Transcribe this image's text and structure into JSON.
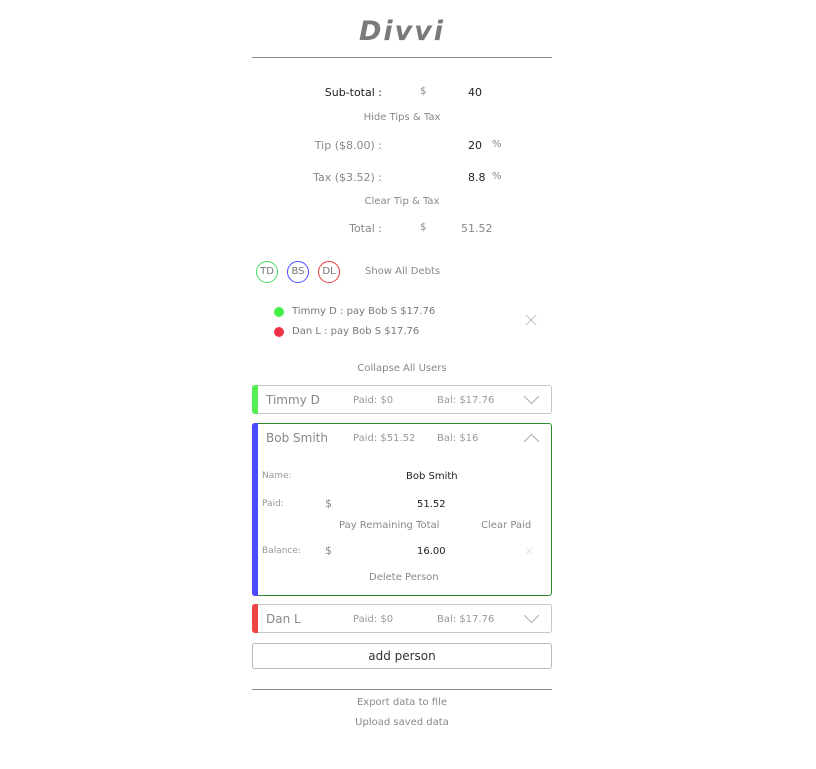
{
  "app": {
    "title": "Divvi"
  },
  "calc": {
    "subtotal_label": "Sub-total :",
    "currency": "$",
    "subtotal_value": "40",
    "hide_tips_label": "Hide Tips & Tax",
    "tip_label": "Tip ($8.00) :",
    "tip_value": "20",
    "tax_label": "Tax ($3.52) :",
    "tax_value": "8.8",
    "percent": "%",
    "clear_tip_tax_label": "Clear Tip & Tax",
    "total_label": "Total :",
    "total_value": "51.52"
  },
  "avatars": [
    {
      "initials": "TD",
      "color": "#4cd964"
    },
    {
      "initials": "BS",
      "color": "#4a4aff"
    },
    {
      "initials": "DL",
      "color": "#ee3b3b"
    }
  ],
  "show_all_debts_label": "Show All Debts",
  "debts": [
    {
      "text": "Timmy D : pay Bob S $17.76",
      "color": "#44ee44"
    },
    {
      "text": "Dan L : pay Bob S $17.76",
      "color": "#ee3344"
    }
  ],
  "collapse_all_label": "Collapse All Users",
  "users": [
    {
      "name": "Timmy D",
      "paid": "Paid: $0",
      "bal": "Bal: $17.76",
      "color": "#55ee55"
    },
    {
      "name": "Bob Smith",
      "paid": "Paid: $51.52",
      "bal": "Bal: $16",
      "color": "#4a4aff"
    },
    {
      "name": "Dan L",
      "paid": "Paid: $0",
      "bal": "Bal: $17.76",
      "color": "#ee4444"
    }
  ],
  "expanded": {
    "name_label": "Name:",
    "name_value": "Bob Smith",
    "paid_label": "Paid:",
    "currency": "$",
    "paid_value": "51.52",
    "pay_remaining_label": "Pay Remaining Total",
    "clear_paid_label": "Clear Paid",
    "balance_label": "Balance:",
    "balance_value": "16.00",
    "delete_label": "Delete Person"
  },
  "add_person_label": "add person",
  "footer": {
    "export_label": "Export data to file",
    "upload_label": "Upload saved data"
  }
}
